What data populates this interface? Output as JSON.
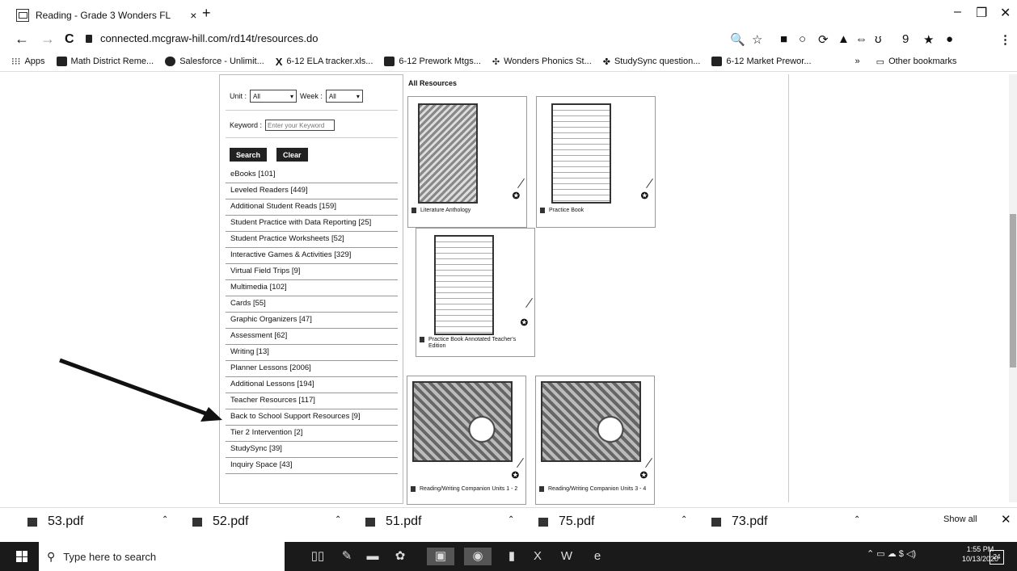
{
  "browser": {
    "tab_title": "Reading - Grade 3 Wonders FL",
    "tab_close": "×",
    "new_tab": "+",
    "window_controls": [
      "–",
      "❐",
      "✕"
    ],
    "nav": {
      "back": "←",
      "forward": "→",
      "reload": "C"
    },
    "url": "connected.mcgraw-hill.com/rd14t/resources.do",
    "toolbar_icons": [
      "🔍",
      "☆",
      "■",
      "○",
      "⟳",
      "▲",
      "⇔",
      "ʊ",
      "9",
      "★",
      "●",
      "⋮"
    ]
  },
  "bookmarks": {
    "items": [
      "Apps",
      "Math District Reme...",
      "Salesforce - Unlimit...",
      "6-12 ELA tracker.xls...",
      "6-12 Prework Mtgs...",
      "Wonders Phonics St...",
      "StudySync question...",
      "6-12 Market Prewor..."
    ],
    "overflow": "»",
    "other": "Other bookmarks"
  },
  "filters": {
    "unit_label": "Unit :",
    "unit_value": "All",
    "week_label": "Week :",
    "week_value": "All",
    "keyword_label": "Keyword :",
    "keyword_placeholder": "Enter your Keyword",
    "search_button": "Search",
    "clear_button": "Clear"
  },
  "categories": [
    "eBooks [101]",
    "Leveled Readers [449]",
    "Additional Student Reads [159]",
    "Student Practice with Data Reporting [25]",
    "Student Practice Worksheets [52]",
    "Interactive Games & Activities [329]",
    "Virtual Field Trips [9]",
    "Multimedia [102]",
    "Cards [55]",
    "Graphic Organizers [47]",
    "Assessment [62]",
    "Writing [13]",
    "Planner Lessons [2006]",
    "Additional Lessons [194]",
    "Teacher Resources [117]",
    "Back to School Support Resources [9]",
    "Tier 2 Intervention [2]",
    "StudySync [39]",
    "Inquiry Space [43]"
  ],
  "resources": {
    "heading": "All Resources",
    "cards": [
      "Literature Anthology",
      "Practice Book",
      "Practice Book Annotated Teacher's Edition",
      "Reading/Writing Companion Units 1 - 2",
      "Reading/Writing Companion Units 3 - 4"
    ]
  },
  "downloads": {
    "files": [
      "53.pdf",
      "52.pdf",
      "51.pdf",
      "75.pdf",
      "73.pdf"
    ],
    "show_all": "Show all",
    "close": "✕"
  },
  "taskbar": {
    "search_placeholder": "Type here to search",
    "time": "1:55 PM",
    "date": "10/13/2020",
    "notifications": "24"
  }
}
